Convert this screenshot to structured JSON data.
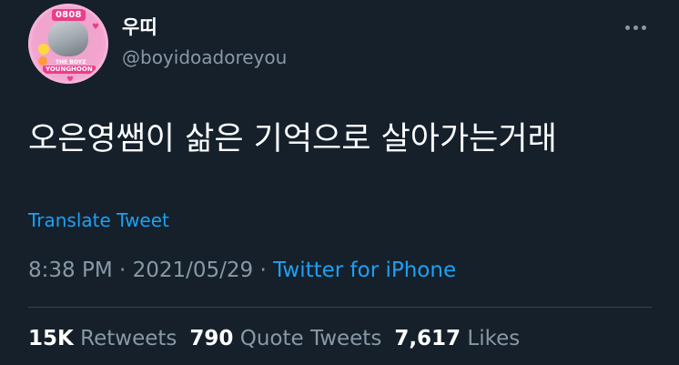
{
  "author": {
    "display_name": "우띠",
    "handle": "@boyidoadoreyou",
    "avatar_icon": "profile-avatar",
    "avatar_badge": "0808",
    "avatar_caption_small": "THE BOYZ",
    "avatar_caption_name": "YOUNGHOON"
  },
  "menu": {
    "icon": "more-horizontal-icon"
  },
  "tweet": {
    "text": "오은영쌤이 삶은 기억으로 살아가는거래",
    "translate_label": "Translate Tweet"
  },
  "meta": {
    "time": "8:38 PM",
    "sep1": " · ",
    "date": "2021/05/29",
    "sep2": " · ",
    "source": "Twitter for iPhone"
  },
  "stats": {
    "retweets_count": "15K",
    "retweets_label": "Retweets",
    "quotes_count": "790",
    "quotes_label": "Quote Tweets",
    "likes_count": "7,617",
    "likes_label": "Likes"
  },
  "colors": {
    "background": "#15202b",
    "text_primary": "#ffffff",
    "text_secondary": "#8899a6",
    "link": "#1da1f2",
    "divider": "#38444d"
  }
}
